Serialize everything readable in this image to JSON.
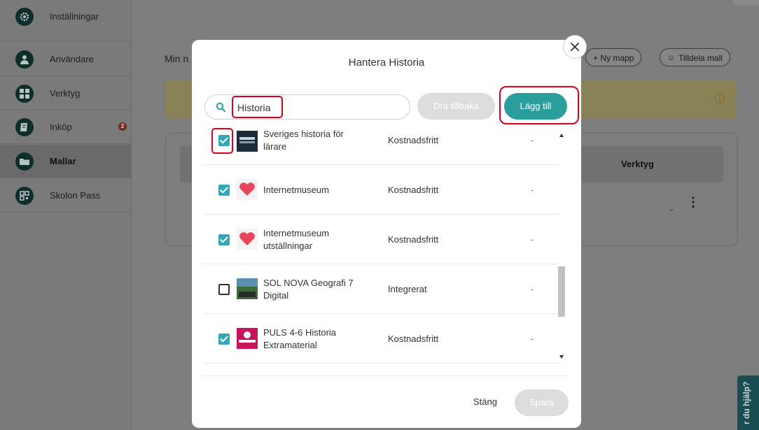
{
  "sidebar": {
    "items": [
      {
        "label": "Inställningar",
        "icon": "gear-icon"
      },
      {
        "label": "Användare",
        "icon": "user-icon"
      },
      {
        "label": "Verktyg",
        "icon": "grid-icon"
      },
      {
        "label": "Inköp",
        "icon": "book-icon",
        "badge": "2"
      },
      {
        "label": "Mallar",
        "icon": "folder-icon",
        "active": true
      },
      {
        "label": "Skolon Pass",
        "icon": "qr-icon"
      }
    ]
  },
  "background": {
    "title": "Min n",
    "new_folder": "+ Ny mapp",
    "assign_template": "Tilldela mall",
    "table_tools_header": "Verktyg",
    "row_dash": "-",
    "help_tab": "r du hjälp?"
  },
  "modal": {
    "title": "Hantera Historia",
    "search_value": "Historia",
    "btn_back": "Dra tillbaka",
    "btn_add": "Lägg till",
    "btn_close": "Stäng",
    "btn_save": "Spara",
    "rows": [
      {
        "name": "Sveriges historia för lärare",
        "price": "Kostnadsfritt",
        "tools": "-",
        "checked": true
      },
      {
        "name": "Internetmuseum",
        "price": "Kostnadsfritt",
        "tools": "-",
        "checked": true
      },
      {
        "name": "Internetmuseum utställningar",
        "price": "Kostnadsfritt",
        "tools": "-",
        "checked": true
      },
      {
        "name": "SOL NOVA Geografi 7 Digital",
        "price": "Integrerat",
        "tools": "-",
        "checked": false
      },
      {
        "name": "PULS 4-6 Historia Extramaterial",
        "price": "Kostnadsfritt",
        "tools": "-",
        "checked": true
      }
    ]
  },
  "colors": {
    "accent": "#2a9d9d",
    "checkbox": "#33a7b5",
    "highlight": "#d9001b",
    "sidebar_icon": "#0f2d2b"
  }
}
